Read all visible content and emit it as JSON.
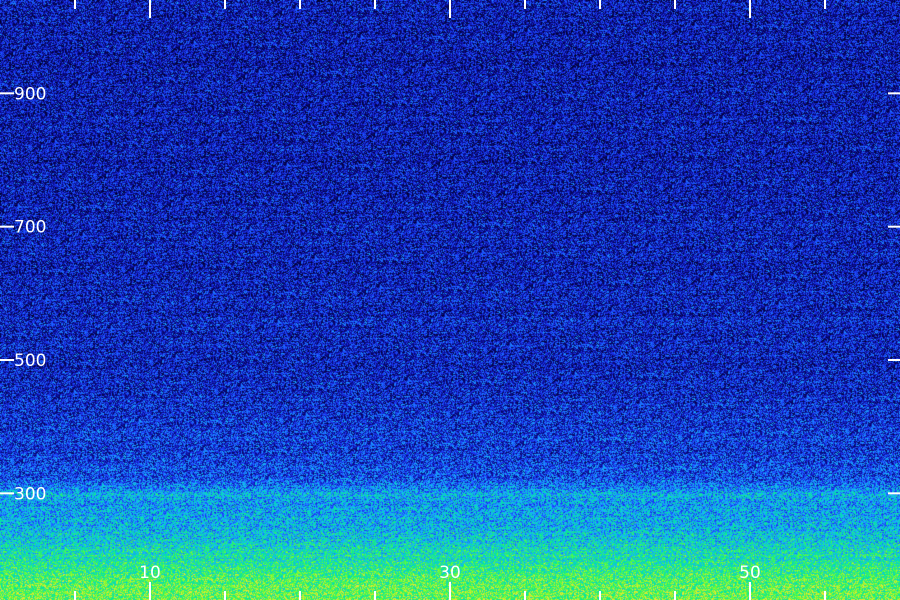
{
  "chart_data": {
    "type": "heatmap",
    "title": "",
    "xlabel": "",
    "ylabel": "",
    "x_tick_labels": [
      {
        "value": 10,
        "text": "10"
      },
      {
        "value": 30,
        "text": "30"
      },
      {
        "value": 50,
        "text": "50"
      }
    ],
    "x_minor_ticks": [
      0,
      5,
      10,
      15,
      20,
      25,
      30,
      35,
      40,
      45,
      50,
      55
    ],
    "xlim": [
      0,
      60
    ],
    "y_tick_labels": [
      {
        "value": 900,
        "text": "900"
      },
      {
        "value": 700,
        "text": "700"
      },
      {
        "value": 500,
        "text": "500"
      },
      {
        "value": 300,
        "text": "300"
      }
    ],
    "ylim": [
      140,
      1040
    ],
    "colormap": [
      "#000020",
      "#0a0a8c",
      "#1e3cff",
      "#19b4ff",
      "#00e6a0",
      "#64ff32",
      "#f0e632"
    ],
    "intensity_profile": {
      "frequency": [
        140,
        170,
        200,
        240,
        280,
        300,
        320,
        360,
        420,
        500,
        700,
        900,
        1040
      ],
      "relative_energy": [
        0.82,
        0.78,
        0.66,
        0.54,
        0.48,
        0.52,
        0.34,
        0.3,
        0.27,
        0.24,
        0.22,
        0.21,
        0.21
      ]
    },
    "tick_color": "#ffffff",
    "background": "#000000",
    "grid": false
  }
}
